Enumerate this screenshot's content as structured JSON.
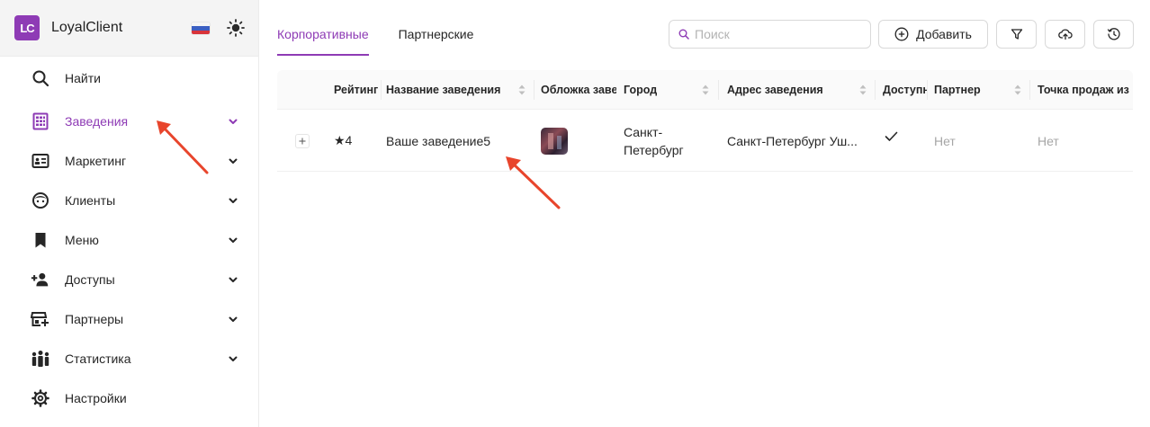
{
  "app": {
    "logo_text": "LC",
    "name": "LoyalClient"
  },
  "colors": {
    "accent": "#8e3bb5",
    "annotation_arrow": "#e8452c"
  },
  "sidebar": {
    "items": [
      {
        "label": "Найти",
        "icon": "search-icon",
        "active": false,
        "has_chevron": false
      },
      {
        "label": "Заведения",
        "icon": "building-grid-icon",
        "active": true,
        "has_chevron": true
      },
      {
        "label": "Маркетинг",
        "icon": "id-card-icon",
        "active": false,
        "has_chevron": true
      },
      {
        "label": "Клиенты",
        "icon": "face-icon",
        "active": false,
        "has_chevron": true
      },
      {
        "label": "Меню",
        "icon": "bookmark-icon",
        "active": false,
        "has_chevron": true
      },
      {
        "label": "Доступы",
        "icon": "user-add-icon",
        "active": false,
        "has_chevron": true
      },
      {
        "label": "Партнеры",
        "icon": "store-add-icon",
        "active": false,
        "has_chevron": true
      },
      {
        "label": "Статистика",
        "icon": "people-group-icon",
        "active": false,
        "has_chevron": true
      },
      {
        "label": "Настройки",
        "icon": "gear-icon",
        "active": false,
        "has_chevron": false
      }
    ]
  },
  "tabs": [
    {
      "label": "Корпоративные",
      "active": true
    },
    {
      "label": "Партнерские",
      "active": false
    }
  ],
  "toolbar": {
    "search_placeholder": "Поиск",
    "add_label": "Добавить"
  },
  "table": {
    "columns": [
      {
        "label": "Рейтинг",
        "sortable": false
      },
      {
        "label": "Название заведения",
        "sortable": true
      },
      {
        "label": "Обложка заведения",
        "sortable": false
      },
      {
        "label": "Город",
        "sortable": true
      },
      {
        "label": "Адрес заведения",
        "sortable": true
      },
      {
        "label": "Доступно",
        "sortable": false
      },
      {
        "label": "Партнер",
        "sortable": true
      },
      {
        "label": "Точка продаж из",
        "sortable": false
      }
    ],
    "rows": [
      {
        "rating": "★4",
        "name": "Ваше заведение5",
        "city_line1": "Санкт-",
        "city_line2": "Петербург",
        "address": "Санкт-Петербург Уш...",
        "available": "✓",
        "partner": "Нет",
        "sales_point": "Нет"
      }
    ]
  }
}
